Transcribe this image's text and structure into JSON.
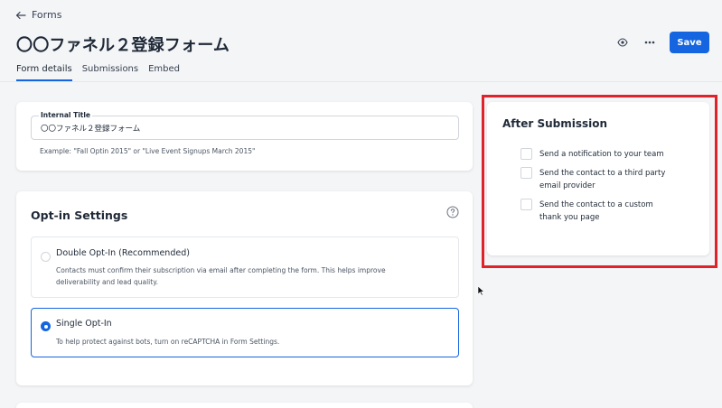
{
  "nav": {
    "back_label": "Forms"
  },
  "page": {
    "title": "〇〇ファネル２登録フォーム"
  },
  "toolbar": {
    "save_label": "Save",
    "accent": "#1565e0"
  },
  "tabs": [
    {
      "label": "Form details",
      "active": true
    },
    {
      "label": "Submissions",
      "active": false
    },
    {
      "label": "Embed",
      "active": false
    }
  ],
  "internal_title": {
    "label": "Internal Title",
    "value": "〇〇ファネル２登録フォーム",
    "help": "Example: \"Fall Optin 2015\" or \"Live Event Signups March 2015\""
  },
  "optin": {
    "title": "Opt-in Settings",
    "options": [
      {
        "title": "Double Opt-In (Recommended)",
        "description": "Contacts must confirm their subscription via email after completing the form. This helps improve deliverability and lead quality.",
        "selected": false
      },
      {
        "title": "Single Opt-In",
        "description": "To help protect against bots, turn on reCAPTCHA in Form Settings.",
        "selected": true
      }
    ]
  },
  "after_submission": {
    "title": "After Submission",
    "highlight_color": "#e0222b",
    "options": [
      {
        "label": "Send a notification to your team",
        "checked": false
      },
      {
        "label": "Send the contact to a third party email provider",
        "checked": false
      },
      {
        "label": "Send the contact to a custom thank you page",
        "checked": false
      }
    ]
  }
}
